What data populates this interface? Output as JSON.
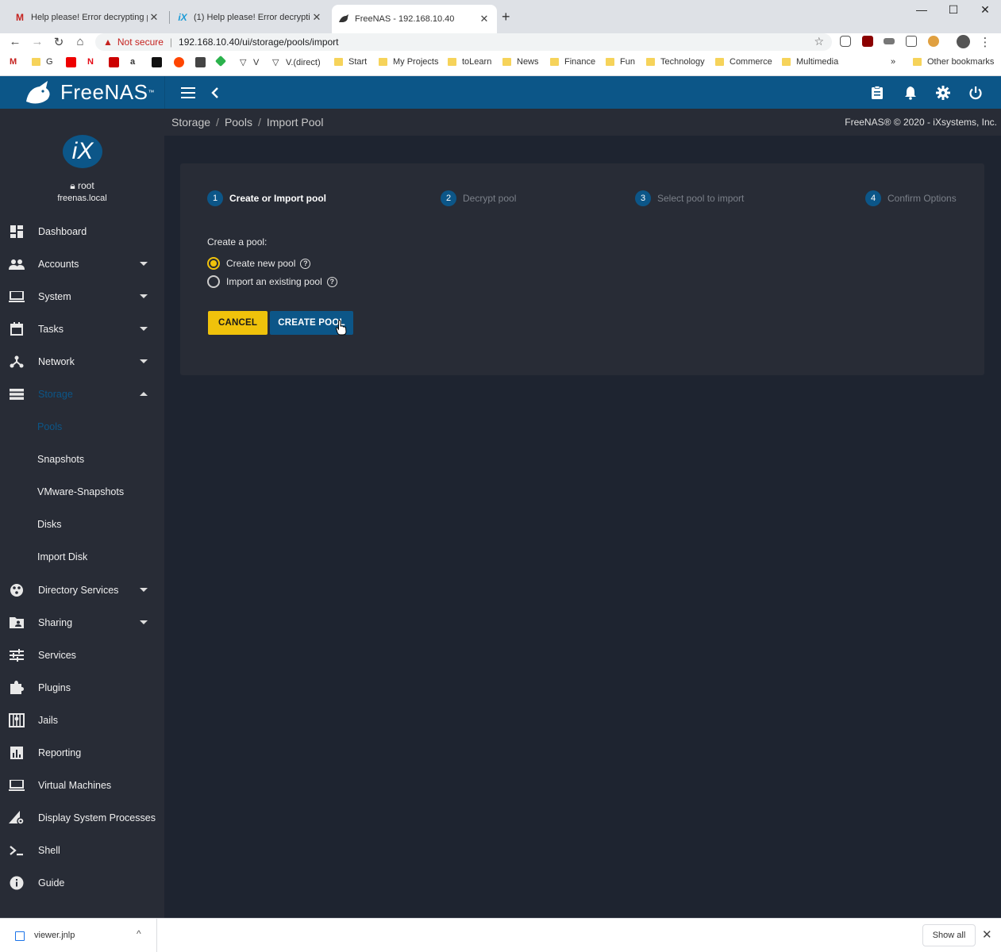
{
  "browser": {
    "tabs": [
      {
        "title": "Help please! Error decrypting po",
        "icon": "gmail-icon",
        "color": "#c5221f"
      },
      {
        "title": "(1) Help please! Error decrypting",
        "icon": "ix-icon",
        "color": "#1a9ad6"
      },
      {
        "title": "FreeNAS - 192.168.10.40",
        "icon": "freenas-shark-icon",
        "color": "#333333"
      }
    ],
    "not_secure": "Not secure",
    "url": "192.168.10.40/ui/storage/pools/import",
    "bookmarks": [
      "G",
      "V",
      "V.(direct)",
      "Start",
      "My Projects",
      "toLearn",
      "News",
      "Finance",
      "Fun",
      "Technology",
      "Commerce",
      "Multimedia"
    ],
    "bookmarks_more": "»",
    "other_bookmarks": "Other bookmarks"
  },
  "app": {
    "brand": "FreeNAS",
    "brand_mark": "™",
    "accent": "#0c5688",
    "warning": "#f0c20b"
  },
  "user": {
    "avatar_text": "iX",
    "name": "root",
    "host": "freenas.local"
  },
  "nav": [
    {
      "label": "Dashboard",
      "icon": "dashboard-icon"
    },
    {
      "label": "Accounts",
      "icon": "people-icon",
      "expandable": true
    },
    {
      "label": "System",
      "icon": "laptop-icon",
      "expandable": true
    },
    {
      "label": "Tasks",
      "icon": "calendar-icon",
      "expandable": true
    },
    {
      "label": "Network",
      "icon": "network-icon",
      "expandable": true
    },
    {
      "label": "Storage",
      "icon": "storage-icon",
      "expandable": true,
      "expanded": true,
      "active": true
    },
    {
      "label": "Directory Services",
      "icon": "directory-icon",
      "expandable": true
    },
    {
      "label": "Sharing",
      "icon": "folder-share-icon",
      "expandable": true
    },
    {
      "label": "Services",
      "icon": "tune-icon"
    },
    {
      "label": "Plugins",
      "icon": "puzzle-icon"
    },
    {
      "label": "Jails",
      "icon": "jail-icon"
    },
    {
      "label": "Reporting",
      "icon": "bar-chart-icon"
    },
    {
      "label": "Virtual Machines",
      "icon": "computer-icon"
    },
    {
      "label": "Display System Processes",
      "icon": "processes-icon"
    },
    {
      "label": "Shell",
      "icon": "terminal-icon"
    },
    {
      "label": "Guide",
      "icon": "info-icon"
    }
  ],
  "storage_sub": [
    "Pools",
    "Snapshots",
    "VMware-Snapshots",
    "Disks",
    "Import Disk"
  ],
  "breadcrumb": [
    "Storage",
    "Pools",
    "Import Pool"
  ],
  "copyright": "FreeNAS® © 2020 - iXsystems, Inc.",
  "wizard": {
    "steps": [
      {
        "num": "1",
        "label": "Create or Import pool",
        "current": true
      },
      {
        "num": "2",
        "label": "Decrypt pool"
      },
      {
        "num": "3",
        "label": "Select pool to import"
      },
      {
        "num": "4",
        "label": "Confirm Options"
      }
    ],
    "form_label": "Create a pool:",
    "options": [
      {
        "label": "Create new pool",
        "checked": true
      },
      {
        "label": "Import an existing pool",
        "checked": false
      }
    ],
    "cancel": "CANCEL",
    "create": "CREATE POOL"
  },
  "downloads": {
    "file": "viewer.jnlp",
    "show_all": "Show all"
  }
}
